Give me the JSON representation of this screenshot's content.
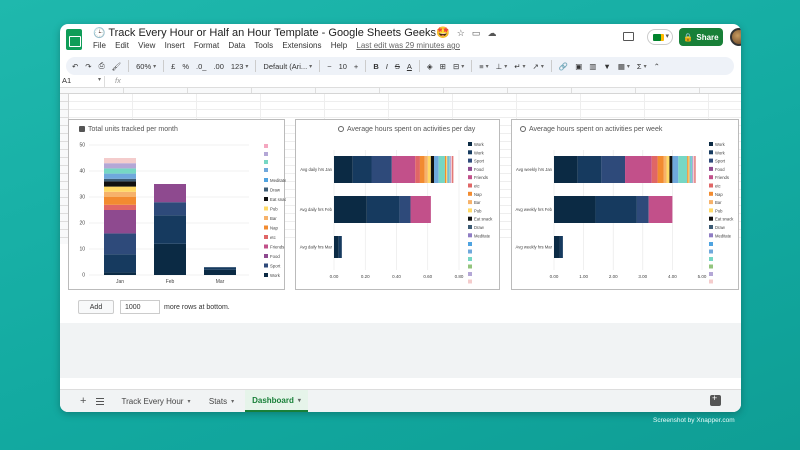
{
  "window": {
    "title": "Track Every Hour or Half an Hour Template - Google Sheets Geeks🤩",
    "title_prefix_icon": "clock-emoji",
    "menu": [
      "File",
      "Edit",
      "View",
      "Insert",
      "Format",
      "Data",
      "Tools",
      "Extensions",
      "Help"
    ],
    "last_edit": "Last edit was 29 minutes ago",
    "share_label": "Share"
  },
  "toolbar": {
    "zoom": "60%",
    "currency": "£",
    "percent": "%",
    "dec_decrease": ".0_",
    "dec_increase": ".00",
    "format_more": "123",
    "font": "Default (Ari...",
    "font_size": "10",
    "bold": "B",
    "italic": "I",
    "strike": "S",
    "text_color": "A",
    "sum": "Σ"
  },
  "formula_bar": {
    "cell_ref": "A1",
    "fx": "fx"
  },
  "charts": {
    "chart1": {
      "title": "Total units tracked per month",
      "y_ticks": [
        "50",
        "40",
        "30",
        "20",
        "10",
        "0"
      ],
      "legend": [
        "Meditate",
        "Draw",
        "Eat snack",
        "Pub",
        "Bar",
        "Nap",
        "etc",
        "Friends",
        "Food",
        "Sport",
        "Work"
      ]
    },
    "chart2": {
      "title": "Average hours spent on activities per day",
      "x_ticks": [
        "0.00",
        "0.20",
        "0.40",
        "0.60",
        "0.80"
      ],
      "legend": [
        "Work",
        "Work",
        "Sport",
        "Food",
        "Friends",
        "etc",
        "Nap",
        "Bar",
        "Pub",
        "Eat snack",
        "Draw",
        "Meditate"
      ]
    },
    "chart3": {
      "title": "Average hours spent on activities per week",
      "x_ticks": [
        "0.00",
        "1.00",
        "2.00",
        "3.00",
        "4.00",
        "5.00"
      ],
      "legend": [
        "Work",
        "Work",
        "Sport",
        "Food",
        "Friends",
        "etc",
        "Nap",
        "Bar",
        "Pub",
        "Eat snack",
        "Draw",
        "Meditate"
      ]
    }
  },
  "chart_data": [
    {
      "type": "bar",
      "title": "Total units tracked per month",
      "stacked": true,
      "categories": [
        "Jan",
        "Feb",
        "Mar"
      ],
      "ylim": [
        0,
        50
      ],
      "series": [
        {
          "name": "Work",
          "color": "#0b2a44",
          "values": [
            1,
            12,
            2
          ]
        },
        {
          "name": "Work",
          "color": "#163a5f",
          "values": [
            7,
            11,
            1
          ]
        },
        {
          "name": "Sport",
          "color": "#2e4a7a",
          "values": [
            8,
            5,
            0
          ]
        },
        {
          "name": "Food",
          "color": "#8e4a8f",
          "values": [
            9,
            7,
            0
          ]
        },
        {
          "name": "Friends",
          "color": "#c2508a",
          "values": [
            0,
            0,
            0
          ]
        },
        {
          "name": "etc",
          "color": "#e06666",
          "values": [
            2,
            0,
            0
          ]
        },
        {
          "name": "Nap",
          "color": "#f28b30",
          "values": [
            3,
            0,
            0
          ]
        },
        {
          "name": "Bar",
          "color": "#f6b26b",
          "values": [
            2,
            0,
            0
          ]
        },
        {
          "name": "Pub",
          "color": "#ffd966",
          "values": [
            2,
            0,
            0
          ]
        },
        {
          "name": "Eat snack",
          "color": "#111111",
          "values": [
            2,
            0,
            0
          ]
        },
        {
          "name": "Draw",
          "color": "#3d5c75",
          "values": [
            1,
            0,
            0
          ]
        },
        {
          "name": "Meditate",
          "color": "#6fa8dc",
          "values": [
            2,
            0,
            0
          ]
        },
        {
          "name": "extra1",
          "color": "#76d7c4",
          "values": [
            2,
            0,
            0
          ]
        },
        {
          "name": "extra2",
          "color": "#b4a7d6",
          "values": [
            2,
            0,
            0
          ]
        },
        {
          "name": "extra3",
          "color": "#f4cccc",
          "values": [
            2,
            0,
            0
          ]
        }
      ]
    },
    {
      "type": "bar",
      "orientation": "horizontal",
      "title": "Average hours spent on activities per day",
      "categories": [
        "Avg daily hrs Jan",
        "Avg daily hrs Feb",
        "Avg daily hrs Mar"
      ],
      "xlim": [
        0,
        0.8
      ],
      "series": [
        {
          "name": "Work",
          "color": "#0b2a44",
          "values": [
            0.12,
            0.21,
            0.03
          ]
        },
        {
          "name": "Work",
          "color": "#163a5f",
          "values": [
            0.12,
            0.21,
            0.02
          ]
        },
        {
          "name": "Sport",
          "color": "#2e4a7a",
          "values": [
            0.13,
            0.07,
            0.0
          ]
        },
        {
          "name": "Food",
          "color": "#c2508a",
          "values": [
            0.15,
            0.13,
            0.0
          ]
        },
        {
          "name": "Friends",
          "color": "#8e4a8f",
          "values": [
            0.0,
            0.0,
            0.0
          ]
        },
        {
          "name": "etc",
          "color": "#e06666",
          "values": [
            0.03,
            0.0,
            0.0
          ]
        },
        {
          "name": "Nap",
          "color": "#f28b30",
          "values": [
            0.03,
            0.0,
            0.0
          ]
        },
        {
          "name": "Bar",
          "color": "#f6b26b",
          "values": [
            0.02,
            0.0,
            0.0
          ]
        },
        {
          "name": "Pub",
          "color": "#ffd966",
          "values": [
            0.02,
            0.0,
            0.0
          ]
        },
        {
          "name": "Eat snack",
          "color": "#111111",
          "values": [
            0.02,
            0.0,
            0.0
          ]
        },
        {
          "name": "Draw",
          "color": "#6fa8dc",
          "values": [
            0.03,
            0.0,
            0.0
          ]
        },
        {
          "name": "Meditate",
          "color": "#76d7c4",
          "values": [
            0.04,
            0.0,
            0.0
          ]
        }
      ]
    },
    {
      "type": "bar",
      "orientation": "horizontal",
      "title": "Average hours spent on activities per week",
      "categories": [
        "Avg weekly hrs Jan",
        "Avg weekly hrs Feb",
        "Avg weekly hrs Mar"
      ],
      "xlim": [
        0,
        5
      ],
      "series": [
        {
          "name": "Work",
          "color": "#0b2a44",
          "values": [
            0.8,
            1.4,
            0.2
          ]
        },
        {
          "name": "Work",
          "color": "#163a5f",
          "values": [
            0.8,
            1.4,
            0.1
          ]
        },
        {
          "name": "Sport",
          "color": "#2e4a7a",
          "values": [
            0.8,
            0.4,
            0.0
          ]
        },
        {
          "name": "Food",
          "color": "#c2508a",
          "values": [
            0.9,
            0.8,
            0.0
          ]
        },
        {
          "name": "Friends",
          "color": "#8e4a8f",
          "values": [
            0.0,
            0.0,
            0.0
          ]
        },
        {
          "name": "etc",
          "color": "#e06666",
          "values": [
            0.2,
            0.0,
            0.0
          ]
        },
        {
          "name": "Nap",
          "color": "#f28b30",
          "values": [
            0.2,
            0.0,
            0.0
          ]
        },
        {
          "name": "Bar",
          "color": "#f6b26b",
          "values": [
            0.1,
            0.0,
            0.0
          ]
        },
        {
          "name": "Pub",
          "color": "#ffd966",
          "values": [
            0.1,
            0.0,
            0.0
          ]
        },
        {
          "name": "Eat snack",
          "color": "#111111",
          "values": [
            0.1,
            0.0,
            0.0
          ]
        },
        {
          "name": "Draw",
          "color": "#6fa8dc",
          "values": [
            0.2,
            0.0,
            0.0
          ]
        },
        {
          "name": "Meditate",
          "color": "#76d7c4",
          "values": [
            0.3,
            0.0,
            0.0
          ]
        }
      ]
    }
  ],
  "bottom": {
    "add_label": "Add",
    "rows_value": "1000",
    "rows_suffix": "more rows at bottom."
  },
  "sheets": [
    {
      "label": "Track Every Hour",
      "active": false
    },
    {
      "label": "Stats",
      "active": false
    },
    {
      "label": "Dashboard",
      "active": true
    }
  ],
  "credit": "Screenshot by Xnapper.com"
}
